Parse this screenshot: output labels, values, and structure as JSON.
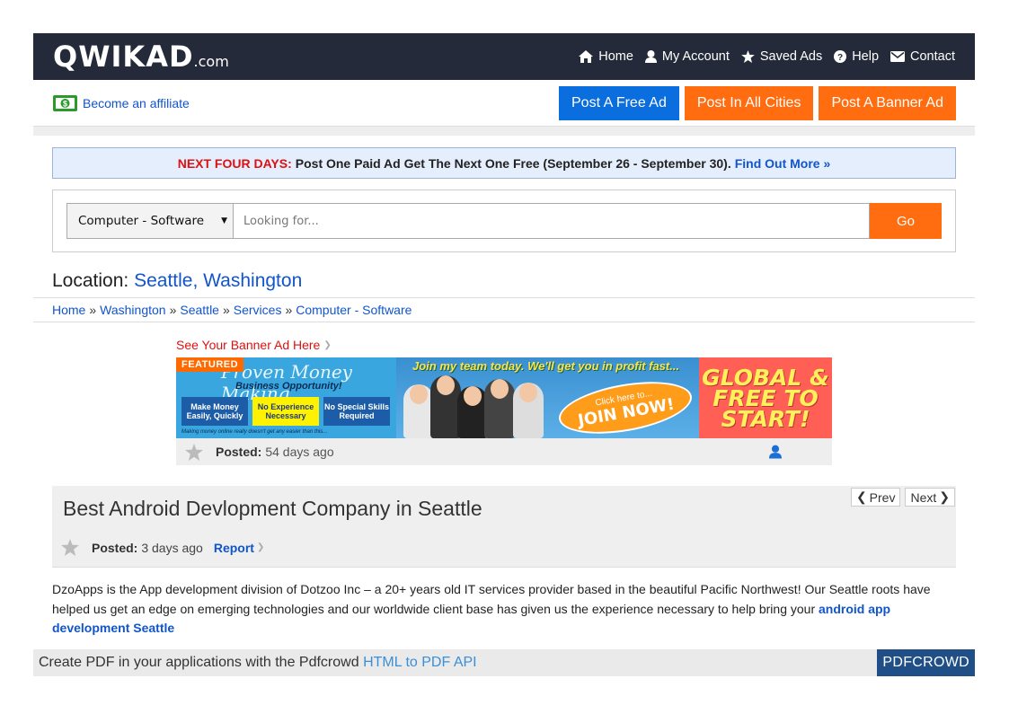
{
  "header": {
    "logo_main": "QWIKAD",
    "logo_suffix": ".com",
    "nav": [
      {
        "label": "Home",
        "icon": "home-icon"
      },
      {
        "label": "My Account",
        "icon": "user-icon"
      },
      {
        "label": "Saved Ads",
        "icon": "star-icon"
      },
      {
        "label": "Help",
        "icon": "question-circle-icon"
      },
      {
        "label": "Contact",
        "icon": "envelope-icon"
      }
    ]
  },
  "subbar": {
    "affiliate_label": "Become an affiliate",
    "affiliate_icon": "money-bill-icon",
    "post_free": "Post A Free Ad",
    "post_all": "Post In All Cities",
    "post_banner": "Post A Banner Ad"
  },
  "promo": {
    "lead": "NEXT FOUR DAYS:",
    "body": "Post One Paid Ad Get The Next One Free (September 26 - September 30).",
    "link": "Find Out More »"
  },
  "search": {
    "category": "Computer - Software",
    "placeholder": "Looking for...",
    "go_label": "Go"
  },
  "location": {
    "label": "Location:",
    "value": "Seattle, Washington"
  },
  "breadcrumb": [
    "Home",
    "Washington",
    "Seattle",
    "Services",
    "Computer - Software"
  ],
  "banner": {
    "cta": "See Your Banner Ad Here",
    "featured": "FEATURED",
    "headline": "Proven Money Making",
    "subheadline": "Business Opportunity!",
    "box1": "Make Money Easily, Quickly",
    "box2": "No Experience Necessary",
    "box3": "No Special Skills Required",
    "fine_print": "Making money online really doesn't get any easier than this...",
    "join_text": "Join my team today. We'll get you in profit fast...",
    "bubble_small": "Click here to...",
    "bubble_big": "JOIN NOW!",
    "right_text": "GLOBAL & FREE TO START!",
    "posted_label": "Posted:",
    "posted_value": "54 days ago"
  },
  "listing": {
    "title": "Best Android Devlopment Company in Seattle",
    "prev": "Prev",
    "next": "Next",
    "posted_label": "Posted:",
    "posted_value": "3 days ago",
    "report": "Report",
    "description": "DzoApps is the App development division of Dotzoo Inc – a 20+ years old IT services provider based in the beautiful Pacific Northwest! Our Seattle roots have helped us  get an edge on emerging technologies and our worldwide client base has given us the experience necessary to help bring your",
    "description_link": "android app development Seattle"
  },
  "footer": {
    "text": "Create PDF in your applications with the Pdfcrowd",
    "link": "HTML to PDF API",
    "brand": "PDFCROWD"
  },
  "colors": {
    "header_bg": "#242a39",
    "link_blue": "#1155cc",
    "orange": "#ff6d10",
    "blue_button": "#0a6ede",
    "promo_red": "#dd1111"
  }
}
